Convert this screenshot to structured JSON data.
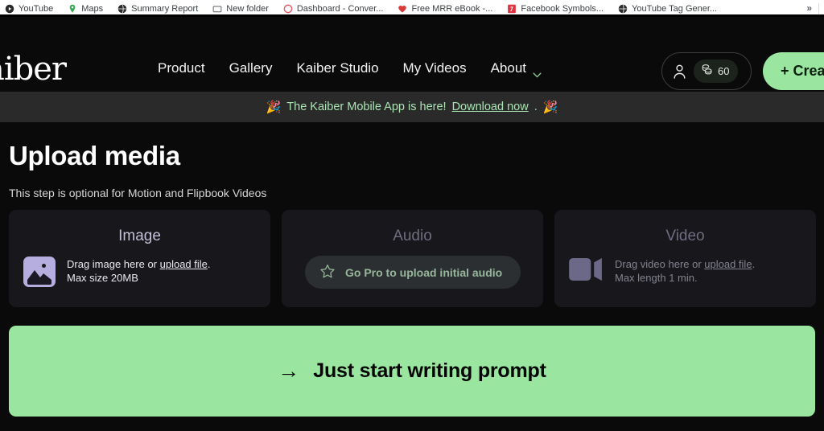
{
  "browser": {
    "bookmarks": [
      {
        "label": "YouTube",
        "icon": "youtube-icon"
      },
      {
        "label": "Maps",
        "icon": "maps-pin-icon"
      },
      {
        "label": "Summary Report",
        "icon": "globe-icon"
      },
      {
        "label": "New folder",
        "icon": "folder-icon"
      },
      {
        "label": "Dashboard - Conver...",
        "icon": "circle-outline-icon"
      },
      {
        "label": "Free MRR eBook -...",
        "icon": "heart-icon"
      },
      {
        "label": "Facebook Symbols...",
        "icon": "red-square-icon"
      },
      {
        "label": "YouTube Tag Gener...",
        "icon": "globe-icon"
      }
    ],
    "overflow_label": "»"
  },
  "header": {
    "logo": "aiber",
    "nav": [
      {
        "label": "Product"
      },
      {
        "label": "Gallery"
      },
      {
        "label": "Kaiber Studio"
      },
      {
        "label": "My Videos"
      },
      {
        "label": "About",
        "has_chevron": true
      }
    ],
    "account_icon": "person-icon",
    "credits_icon": "coins-icon",
    "credits_value": "60",
    "create_button": "+ Create",
    "accent_green": "#9ae6a0"
  },
  "banner": {
    "emoji_left": "🎉",
    "text": "The Kaiber Mobile App is here!",
    "link": "Download now",
    "period": ".",
    "emoji_right": "🎉",
    "color": "#a9e5b3"
  },
  "main": {
    "title": "Upload media",
    "subtitle": "This step is optional for Motion and Flipbook Videos",
    "cards": [
      {
        "title": "Image",
        "icon": "image-icon",
        "line1_prefix": "Drag image here or ",
        "line1_link": "upload file",
        "line1_suffix": ".",
        "line2": "Max size 20MB",
        "disabled": false
      },
      {
        "title": "Audio",
        "icon": "star-icon",
        "pro_label": "Go Pro to upload initial audio",
        "disabled": true
      },
      {
        "title": "Video",
        "icon": "video-camera-icon",
        "line1_prefix": "Drag video here or ",
        "line1_link": "upload file",
        "line1_suffix": ".",
        "line2": "Max length 1 min.",
        "disabled": true
      }
    ],
    "cta": {
      "arrow": "→",
      "label": "Just start writing prompt",
      "color": "#9ae6a0"
    }
  }
}
